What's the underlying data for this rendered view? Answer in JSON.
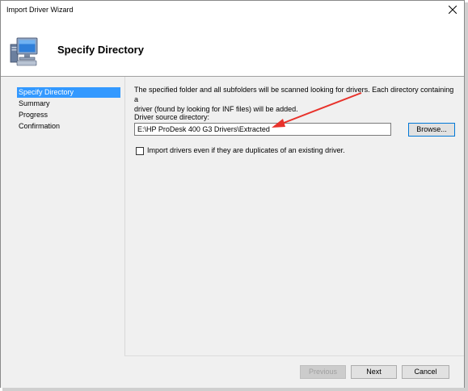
{
  "window": {
    "title": "Import Driver Wizard"
  },
  "header": {
    "title": "Specify Directory",
    "icon": "computer-icon"
  },
  "nav": {
    "items": [
      {
        "label": "Specify Directory",
        "active": true
      },
      {
        "label": "Summary",
        "active": false
      },
      {
        "label": "Progress",
        "active": false
      },
      {
        "label": "Confirmation",
        "active": false
      }
    ]
  },
  "content": {
    "description_line1": "The specified folder and all subfolders will be scanned looking for drivers. Each directory containing a",
    "description_line2": "driver (found by looking for INF files) will be added.",
    "source_label": "Driver source directory:",
    "source_value": "E:\\HP ProDesk 400 G3 Drivers\\Extracted",
    "browse_label": "Browse...",
    "duplicate_checkbox_label": "Import drivers even if they are duplicates of an existing driver.",
    "duplicate_checked": false
  },
  "footer": {
    "previous_label": "Previous",
    "next_label": "Next",
    "cancel_label": "Cancel"
  },
  "colors": {
    "selection": "#3399ff",
    "annotation_arrow": "#e8322b",
    "focus_border": "#0078d7"
  }
}
